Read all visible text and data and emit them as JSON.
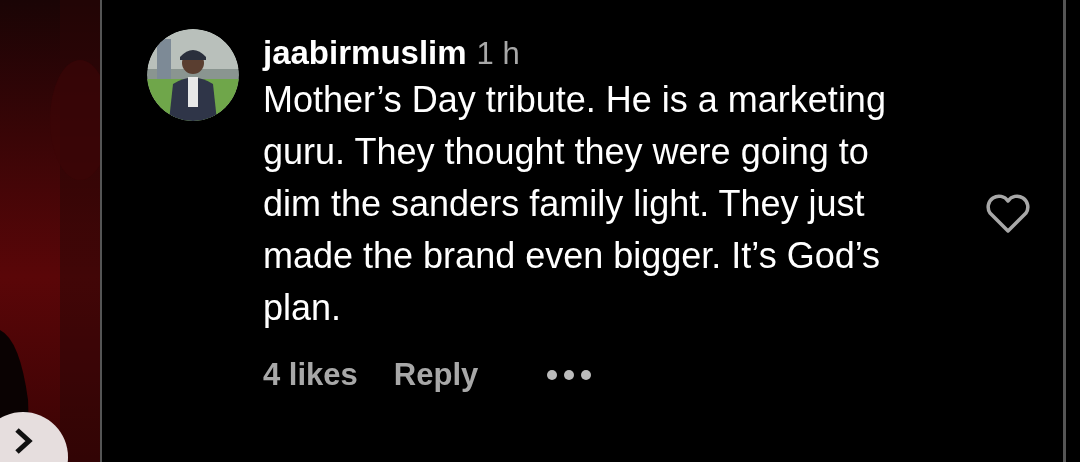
{
  "comment": {
    "username": "jaabirmuslim",
    "time": "1 h",
    "text": "Mother’s Day tribute. He is a marketing guru. They thought they were going to dim the sanders family light. They just made the brand even bigger. It’s God’s plan.",
    "likes": "4 likes",
    "reply": "Reply",
    "liked": false
  }
}
